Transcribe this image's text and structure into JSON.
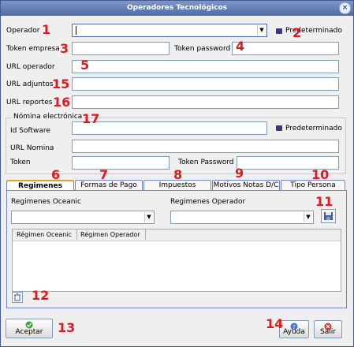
{
  "window": {
    "title": "Operadores Tecnológicos",
    "close_glyph": "×"
  },
  "form": {
    "operador_label": "Operador",
    "predeterminado_label": "Predeterminado",
    "token_empresa_label": "Token empresa",
    "token_password_label": "Token password",
    "url_operador_label": "URL operador",
    "url_adjuntos_label": "URL adjuntos",
    "url_reportes_label": "URL reportes"
  },
  "nomina": {
    "legend": "Nómina electrónica",
    "id_software_label": "Id Software",
    "predeterminado_label": "Predeterminado",
    "url_nomina_label": "URL Nomina",
    "token_label": "Token",
    "token_password_label": "Token Password"
  },
  "tabs": [
    {
      "label": "Regimenes"
    },
    {
      "label": "Formas de Pago"
    },
    {
      "label": "Impuestos"
    },
    {
      "label": "Motivos Notas D/C"
    },
    {
      "label": "Tipo Persona"
    }
  ],
  "regimenes": {
    "oceanic_label": "Regimenes Oceanic",
    "operador_label": "Regimenes Operador",
    "columns": [
      "Régimen Oceanic",
      "Régimen Operador"
    ]
  },
  "buttons": {
    "aceptar": "Aceptar",
    "ayuda": "Ayuda",
    "salir": "Salir",
    "dropdown_glyph": "▼"
  },
  "annotations": [
    "1",
    "2",
    "3",
    "4",
    "5",
    "15",
    "16",
    "17",
    "6",
    "7",
    "8",
    "9",
    "10",
    "11",
    "12",
    "13",
    "14"
  ],
  "icons": {
    "close": "close-icon",
    "save": "save-icon",
    "delete": "delete-icon",
    "accept": "check-icon",
    "help": "help-icon",
    "exit": "exit-icon"
  },
  "colors": {
    "annotation": "#e2191b",
    "titlebar": "#4f6aa6",
    "active_tab_accent": "#e4a22c"
  }
}
